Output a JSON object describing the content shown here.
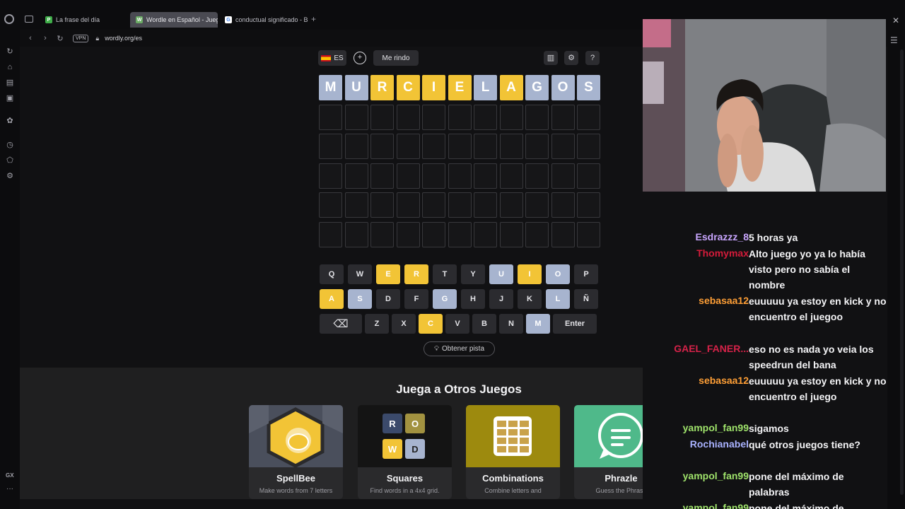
{
  "browser": {
    "tabs": [
      {
        "label": "La frase del día",
        "favicon": "P",
        "favicon_color": "#3fae49",
        "active": false
      },
      {
        "label": "Wordle en Español - Juego",
        "favicon": "W",
        "favicon_color": "#6aaa64",
        "active": true
      },
      {
        "label": "conductual significado - B",
        "favicon": "G",
        "favicon_color": "#ffffff",
        "active": false
      }
    ],
    "vpn_label": "VPN",
    "url": "wordly.org/es"
  },
  "sidebar": {
    "gx_label": "GX"
  },
  "toolbar": {
    "language": "ES",
    "give_up": "Me rindo"
  },
  "board": {
    "rows": [
      [
        {
          "letter": "M",
          "state": "gray"
        },
        {
          "letter": "U",
          "state": "gray"
        },
        {
          "letter": "R",
          "state": "yellow"
        },
        {
          "letter": "C",
          "state": "yellow"
        },
        {
          "letter": "I",
          "state": "yellow"
        },
        {
          "letter": "E",
          "state": "yellow"
        },
        {
          "letter": "L",
          "state": "gray"
        },
        {
          "letter": "A",
          "state": "yellow"
        },
        {
          "letter": "G",
          "state": "gray"
        },
        {
          "letter": "O",
          "state": "gray"
        },
        {
          "letter": "S",
          "state": "gray"
        }
      ]
    ],
    "total_rows": 6,
    "columns": 11
  },
  "keyboard": {
    "rows": [
      [
        {
          "k": "Q",
          "s": ""
        },
        {
          "k": "W",
          "s": ""
        },
        {
          "k": "E",
          "s": "yellow"
        },
        {
          "k": "R",
          "s": "yellow"
        },
        {
          "k": "T",
          "s": ""
        },
        {
          "k": "Y",
          "s": ""
        },
        {
          "k": "U",
          "s": "gray"
        },
        {
          "k": "I",
          "s": "yellow"
        },
        {
          "k": "O",
          "s": "gray"
        },
        {
          "k": "P",
          "s": ""
        }
      ],
      [
        {
          "k": "A",
          "s": "yellow"
        },
        {
          "k": "S",
          "s": "gray"
        },
        {
          "k": "D",
          "s": ""
        },
        {
          "k": "F",
          "s": ""
        },
        {
          "k": "G",
          "s": "gray"
        },
        {
          "k": "H",
          "s": ""
        },
        {
          "k": "J",
          "s": ""
        },
        {
          "k": "K",
          "s": ""
        },
        {
          "k": "L",
          "s": "gray"
        },
        {
          "k": "Ñ",
          "s": ""
        }
      ],
      [
        {
          "k": "⌫",
          "s": "",
          "special": "backspace"
        },
        {
          "k": "Z",
          "s": ""
        },
        {
          "k": "X",
          "s": ""
        },
        {
          "k": "C",
          "s": "yellow"
        },
        {
          "k": "V",
          "s": ""
        },
        {
          "k": "B",
          "s": ""
        },
        {
          "k": "N",
          "s": ""
        },
        {
          "k": "M",
          "s": "gray"
        },
        {
          "k": "Enter",
          "s": "",
          "special": "enter"
        }
      ]
    ]
  },
  "hint_label": "Obtener pista",
  "other_games": {
    "title": "Juega a Otros Juegos",
    "games": [
      {
        "name": "SpellBee",
        "desc": "Make words from 7 letters",
        "color": "#4a4f5c"
      },
      {
        "name": "Squares",
        "desc": "Find words in a 4x4 grid.",
        "color": "#141414"
      },
      {
        "name": "Combinations",
        "desc": "Combine letters and",
        "color": "#9d8a0e"
      },
      {
        "name": "Phrazle",
        "desc": "Guess the Phrase",
        "color": "#4fb98a"
      }
    ]
  },
  "squares_letters": [
    "R",
    "O",
    "W",
    "D"
  ],
  "chat": {
    "messages": [
      {
        "user": "Esdrazzz_8",
        "color": "#c9a6ff",
        "text": "5 horas ya"
      },
      {
        "user": "Thomymax",
        "color": "#d41b3a",
        "text": "Alto juego yo ya lo había visto pero no sabía el nombre"
      },
      {
        "user": "sebasaa12",
        "color": "#ff9f36",
        "text": "euuuuu ya estoy en kick y no encuentro el juegoo"
      },
      {
        "user": "GAEL_FANER...",
        "color": "#d62249",
        "text": "eso no es nada yo veia los speedrun del bana"
      },
      {
        "user": "sebasaa12",
        "color": "#ff9f36",
        "text": "euuuuu ya estoy en kick y no encuentro el juego"
      },
      {
        "user": "yampol_fan99",
        "color": "#9fe36b",
        "text": "sigamos"
      },
      {
        "user": "Rochianabel",
        "color": "#a9b2ff",
        "text": "qué otros juegos tiene?"
      },
      {
        "user": "yampol_fan99",
        "color": "#9fe36b",
        "text": "pone del máximo de palabras"
      },
      {
        "user": "yampol_fan99",
        "color": "#9fe36b",
        "text": "pone del máximo de palabras"
      }
    ]
  }
}
